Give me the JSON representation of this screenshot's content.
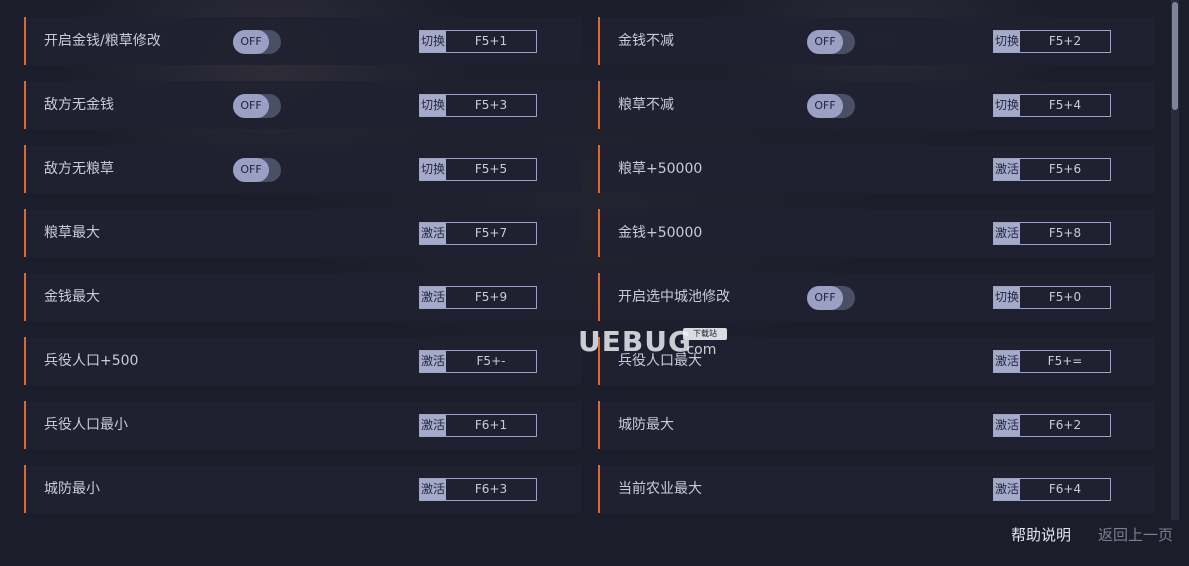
{
  "colors": {
    "background": "#1c1d2b",
    "row_bg": "#202130",
    "accent": "#e2672c",
    "toggle_knob": "#9aa0c4",
    "toggle_track": "#4b4e67"
  },
  "watermark": {
    "text": "UEBUG",
    "suffix": ".com",
    "tag": "下载站"
  },
  "cheats": {
    "left": [
      {
        "label": "开启金钱/粮草修改",
        "toggle": "OFF",
        "mode": "切换",
        "key": "F5+1"
      },
      {
        "label": "敌方无金钱",
        "toggle": "OFF",
        "mode": "切换",
        "key": "F5+3"
      },
      {
        "label": "敌方无粮草",
        "toggle": "OFF",
        "mode": "切换",
        "key": "F5+5"
      },
      {
        "label": "粮草最大",
        "mode": "激活",
        "key": "F5+7"
      },
      {
        "label": "金钱最大",
        "mode": "激活",
        "key": "F5+9"
      },
      {
        "label": "兵役人口+500",
        "mode": "激活",
        "key": "F5+-"
      },
      {
        "label": "兵役人口最小",
        "mode": "激活",
        "key": "F6+1"
      },
      {
        "label": "城防最小",
        "mode": "激活",
        "key": "F6+3"
      }
    ],
    "right": [
      {
        "label": "金钱不减",
        "toggle": "OFF",
        "mode": "切换",
        "key": "F5+2"
      },
      {
        "label": "粮草不减",
        "toggle": "OFF",
        "mode": "切换",
        "key": "F5+4"
      },
      {
        "label": "粮草+50000",
        "mode": "激活",
        "key": "F5+6"
      },
      {
        "label": "金钱+50000",
        "mode": "激活",
        "key": "F5+8"
      },
      {
        "label": "开启选中城池修改",
        "toggle": "OFF",
        "mode": "切换",
        "key": "F5+0"
      },
      {
        "label": "兵役人口最大",
        "mode": "激活",
        "key": "F5+="
      },
      {
        "label": "城防最大",
        "mode": "激活",
        "key": "F6+2"
      },
      {
        "label": "当前农业最大",
        "mode": "激活",
        "key": "F6+4"
      }
    ]
  },
  "footer": {
    "help": "帮助说明",
    "back": "返回上一页"
  }
}
